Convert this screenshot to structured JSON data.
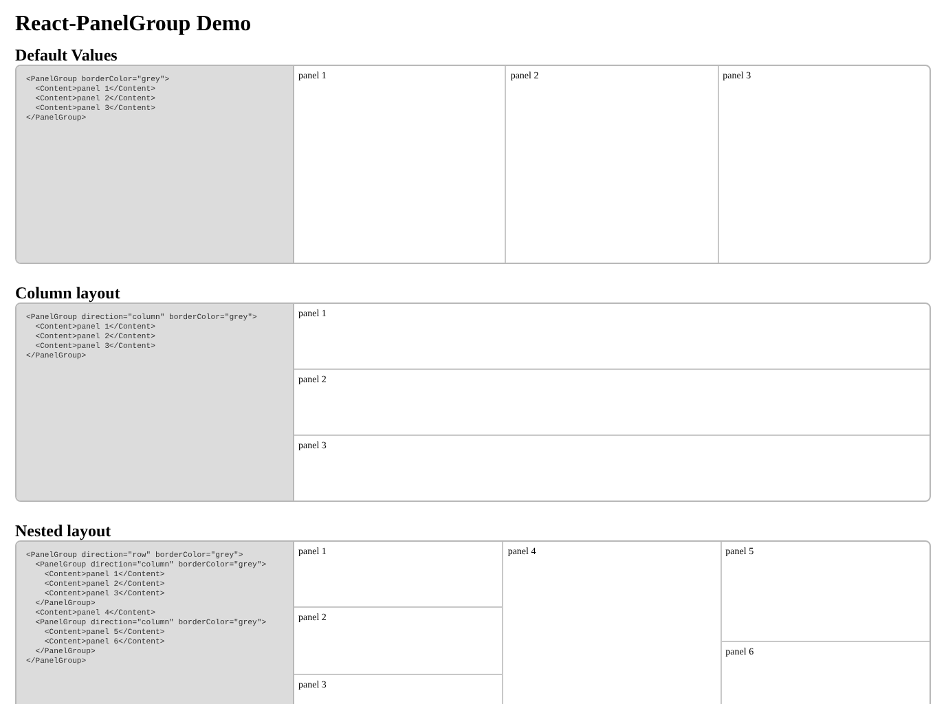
{
  "title": "React-PanelGroup Demo",
  "sections": [
    {
      "heading": "Default Values",
      "code": [
        "<PanelGroup borderColor=\"grey\">",
        "  <Content>panel 1</Content>",
        "  <Content>panel 2</Content>",
        "  <Content>panel 3</Content>",
        "</PanelGroup>"
      ],
      "layout": {
        "kind": "row",
        "children": [
          {
            "kind": "content",
            "label": "panel 1"
          },
          {
            "kind": "content",
            "label": "panel 2"
          },
          {
            "kind": "content",
            "label": "panel 3"
          }
        ]
      }
    },
    {
      "heading": "Column layout",
      "code": [
        "<PanelGroup direction=\"column\" borderColor=\"grey\">",
        "  <Content>panel 1</Content>",
        "  <Content>panel 2</Content>",
        "  <Content>panel 3</Content>",
        "</PanelGroup>"
      ],
      "layout": {
        "kind": "column",
        "children": [
          {
            "kind": "content",
            "label": "panel 1"
          },
          {
            "kind": "content",
            "label": "panel 2"
          },
          {
            "kind": "content",
            "label": "panel 3"
          }
        ]
      }
    },
    {
      "heading": "Nested layout",
      "code": [
        "<PanelGroup direction=\"row\" borderColor=\"grey\">",
        "  <PanelGroup direction=\"column\" borderColor=\"grey\">",
        "    <Content>panel 1</Content>",
        "    <Content>panel 2</Content>",
        "    <Content>panel 3</Content>",
        "  </PanelGroup>",
        "  <Content>panel 4</Content>",
        "  <PanelGroup direction=\"column\" borderColor=\"grey\">",
        "    <Content>panel 5</Content>",
        "    <Content>panel 6</Content>",
        "  </PanelGroup>",
        "</PanelGroup>"
      ],
      "layout": {
        "kind": "row",
        "children": [
          {
            "kind": "column",
            "children": [
              {
                "kind": "content",
                "label": "panel 1"
              },
              {
                "kind": "content",
                "label": "panel 2"
              },
              {
                "kind": "content",
                "label": "panel 3"
              }
            ]
          },
          {
            "kind": "content",
            "label": "panel 4"
          },
          {
            "kind": "column",
            "children": [
              {
                "kind": "content",
                "label": "panel 5"
              },
              {
                "kind": "content",
                "label": "panel 6"
              }
            ]
          }
        ]
      }
    }
  ]
}
